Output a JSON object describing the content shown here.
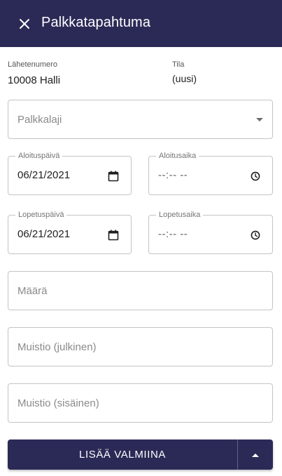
{
  "header": {
    "title": "Palkkatapahtuma",
    "close_icon": "close-icon",
    "background": "#2b2a57"
  },
  "info": {
    "reference_label": "Lähetenumero",
    "reference_value": "10008 Halli",
    "status_label": "Tila",
    "status_value": "(uusi)"
  },
  "form": {
    "wage_type": {
      "placeholder": "Palkkalaji",
      "icon": "dropdown-arrow-icon"
    },
    "start_date": {
      "label": "Aloituspäivä",
      "value": "06/21/2021",
      "icon": "calendar-icon"
    },
    "start_time": {
      "label": "Aloitusaika",
      "value": "--:-- --",
      "icon": "clock-icon"
    },
    "end_date": {
      "label": "Lopetuspäivä",
      "value": "06/21/2021",
      "icon": "calendar-icon"
    },
    "end_time": {
      "label": "Lopetusaika",
      "value": "--:-- --",
      "icon": "clock-icon"
    },
    "amount": {
      "placeholder": "Määrä"
    },
    "public_note": {
      "placeholder": "Muistio (julkinen)"
    },
    "internal_note": {
      "placeholder": "Muistio (sisäinen)"
    }
  },
  "actions": {
    "submit_label": "LISÄÄ VALMIINA",
    "menu_icon": "arrow-up-icon"
  }
}
